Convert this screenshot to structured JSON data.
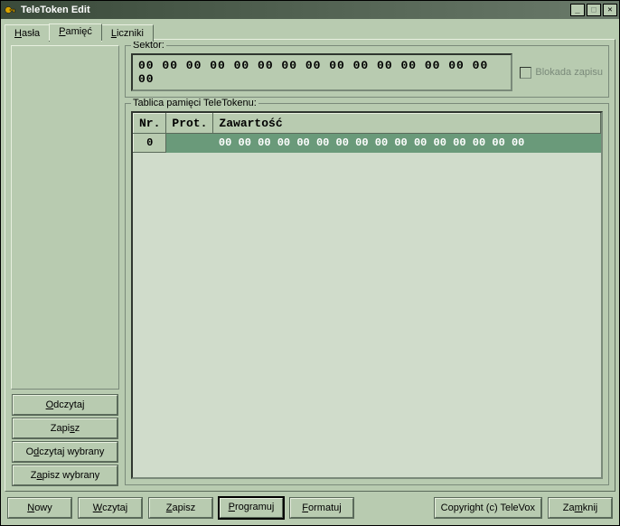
{
  "window": {
    "title": "TeleToken Edit"
  },
  "tabs": {
    "hasla": "Hasła",
    "pamiec": "Pamięć",
    "liczniki": "Liczniki"
  },
  "sektor": {
    "label": "Sektor:",
    "value": "00 00 00 00 00 00 00 00 00 00 00 00 00 00 00 00",
    "lock_label": "Blokada zapisu"
  },
  "table": {
    "label": "Tablica pamięci TeleTokenu:",
    "headers": {
      "nr": "Nr.",
      "prot": "Prot.",
      "content": "Zawartość"
    },
    "rows": [
      {
        "nr": "0",
        "prot": "",
        "content": "00 00 00 00 00 00 00 00 00 00 00 00 00 00 00 00"
      }
    ]
  },
  "left_buttons": {
    "read": "Odczytaj",
    "save": "Zapisz",
    "read_selected": "Odczytaj wybrany",
    "save_selected": "Zapisz wybrany"
  },
  "bottom_buttons": {
    "new": "Nowy",
    "load": "Wczytaj",
    "save": "Zapisz",
    "program": "Programuj",
    "format": "Formatuj",
    "copyright": "Copyright (c) TeleVox",
    "close": "Zamknij"
  }
}
